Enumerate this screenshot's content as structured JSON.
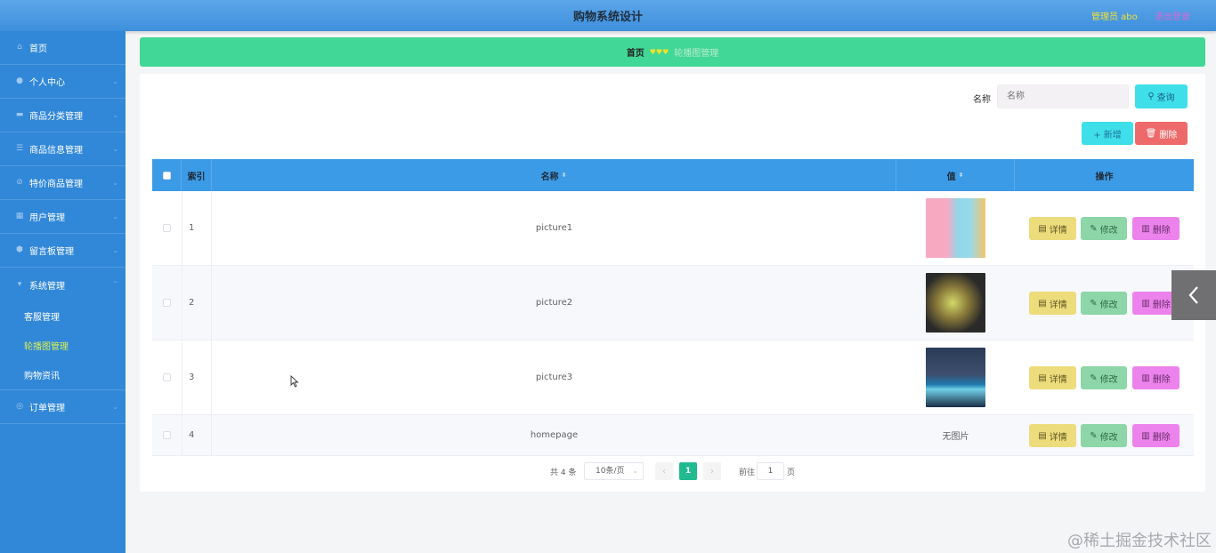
{
  "header": {
    "title": "购物系统设计",
    "user": "管理员 abo",
    "logout": "退出登录"
  },
  "sidebar": {
    "items": [
      {
        "label": "首页",
        "icon": "home-icon",
        "arrow": false
      },
      {
        "label": "个人中心",
        "icon": "user-icon",
        "arrow": true
      },
      {
        "label": "商品分类管理",
        "icon": "category-icon",
        "arrow": true
      },
      {
        "label": "商品信息管理",
        "icon": "list-icon",
        "arrow": true
      },
      {
        "label": "特价商品管理",
        "icon": "discount-icon",
        "arrow": true
      },
      {
        "label": "用户管理",
        "icon": "users-icon",
        "arrow": true
      },
      {
        "label": "留言板管理",
        "icon": "message-icon",
        "arrow": true
      },
      {
        "label": "系统管理",
        "icon": "settings-icon",
        "arrow": true
      }
    ],
    "sub_items": [
      {
        "label": "客服管理",
        "active": false
      },
      {
        "label": "轮播图管理",
        "active": true
      },
      {
        "label": "购物资讯",
        "active": false
      }
    ],
    "last_item": {
      "label": "订单管理",
      "icon": "order-icon"
    }
  },
  "breadcrumb": {
    "home": "首页",
    "hearts": "♥♥♥",
    "current": "轮播图管理"
  },
  "search": {
    "label": "名称",
    "placeholder": "名称",
    "query_label": "查询"
  },
  "toolbar": {
    "add_label": "+ 新增",
    "delete_label": "删除"
  },
  "table": {
    "columns": [
      "索引",
      "名称",
      "值",
      "操作"
    ],
    "rows": [
      {
        "index": "1",
        "name": "picture1",
        "value": "image",
        "img_colors": [
          "#f7a9c2",
          "#8ed7ea",
          "#f3c46a"
        ]
      },
      {
        "index": "2",
        "name": "picture2",
        "value": "image",
        "img_colors": [
          "#2b2a2a",
          "#d2d86a",
          "#7b5a3a"
        ]
      },
      {
        "index": "3",
        "name": "picture3",
        "value": "image",
        "img_colors": [
          "#2a3b57",
          "#1f7ab0",
          "#6fd0e6"
        ]
      },
      {
        "index": "4",
        "name": "homepage",
        "value": "无图片"
      }
    ],
    "actions": {
      "detail": "详情",
      "edit": "修改",
      "delete": "删除"
    }
  },
  "pagination": {
    "total": "共 4 条",
    "page_size": "10条/页",
    "current_page": "1",
    "goto_label": "前往",
    "goto_value": "1",
    "page_suffix": "页"
  },
  "watermark": "@稀土掘金技术社区",
  "colors": {
    "accent_green": "#41d796",
    "sidebar": "#3288d8",
    "header": "#3c9be6"
  }
}
